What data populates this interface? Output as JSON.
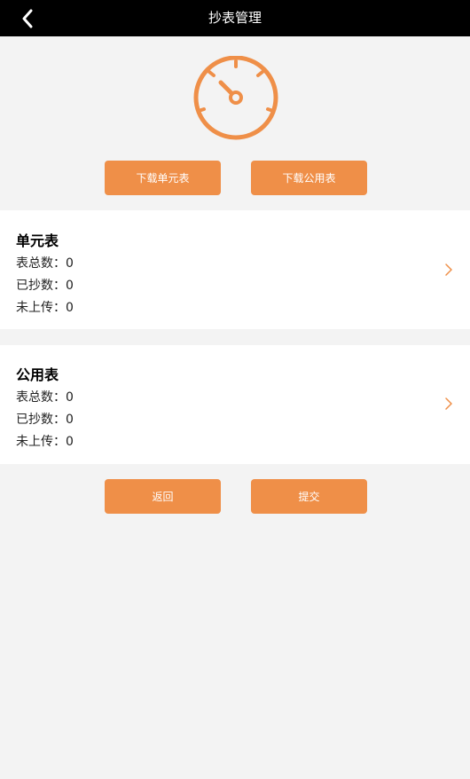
{
  "header": {
    "title": "抄表管理"
  },
  "actions": {
    "download_unit_label": "下载单元表",
    "download_public_label": "下载公用表",
    "back_label": "返回",
    "submit_label": "提交"
  },
  "unit_meter": {
    "title": "单元表",
    "total": "表总数：0",
    "read": "已抄数：0",
    "not_uploaded": "未上传：0"
  },
  "public_meter": {
    "title": "公用表",
    "total": "表总数：0",
    "read": "已抄数：0",
    "not_uploaded": "未上传：0"
  },
  "colors": {
    "accent": "#ef8f48",
    "header_bg": "#000000",
    "page_bg": "#f3f3f3"
  }
}
